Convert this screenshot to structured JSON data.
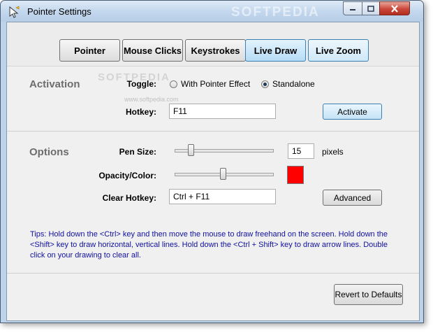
{
  "window": {
    "title": "Pointer Settings",
    "watermark": "SOFTPEDIA"
  },
  "tabs": [
    {
      "label": "Pointer"
    },
    {
      "label": "Mouse Clicks"
    },
    {
      "label": "Keystrokes"
    },
    {
      "label": "Live Draw"
    },
    {
      "label": "Live Zoom"
    }
  ],
  "activation": {
    "section_title": "Activation",
    "toggle_label": "Toggle:",
    "radio_pointer_effect": "With Pointer Effect",
    "radio_standalone": "Standalone",
    "selected_mode": "Standalone",
    "hotkey_label": "Hotkey:",
    "hotkey_value": "F11",
    "activate_button": "Activate"
  },
  "options": {
    "section_title": "Options",
    "pen_size_label": "Pen Size:",
    "pen_size_value": "15",
    "pen_size_unit": "pixels",
    "pen_size_slider_fraction": 0.2,
    "opacity_label": "Opacity/Color:",
    "opacity_slider_fraction": 0.5,
    "color": "#ff0000",
    "clear_hotkey_label": "Clear Hotkey:",
    "clear_hotkey_value": "Ctrl + F11",
    "advanced_button": "Advanced"
  },
  "tips": "Tips: Hold down the <Ctrl> key and then move the mouse to draw freehand on the screen. Hold down the <Shift> key to draw horizontal, vertical lines. Hold down the <Ctrl + Shift> key to draw arrow lines. Double click on your drawing to clear all.",
  "footer": {
    "revert_button": "Revert to Defaults"
  },
  "softpedia": {
    "overlay": "SOFTPEDIA",
    "url": "www.softpedia.com"
  },
  "colors": {
    "accent": "#3c7fb1",
    "tips_text": "#1010a0",
    "section_label": "#6d6d6d"
  }
}
